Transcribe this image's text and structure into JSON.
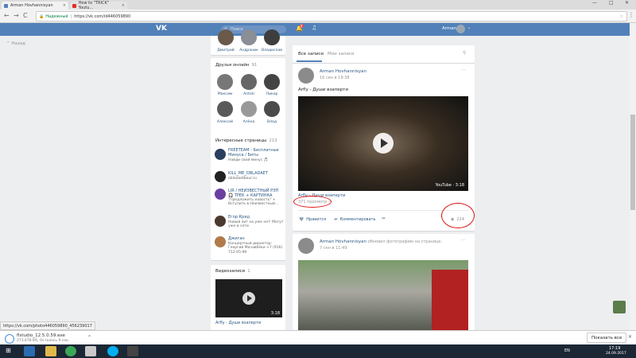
{
  "browser": {
    "tabs": [
      {
        "label": "Arman Hovhannisyan"
      },
      {
        "label": "How to \"TRICK\" Youtu..."
      }
    ],
    "nav": {
      "back": "←",
      "forward": "→",
      "reload": "C"
    },
    "address": {
      "secure_label": "Надежный",
      "url": "https://vk.com/id446059890"
    },
    "window_controls": {
      "minimize": "—",
      "maximize": "□",
      "close": "✕"
    }
  },
  "vk_header": {
    "logo": "VK",
    "search_placeholder": "Поиск",
    "notifications_count": "8",
    "user_name": "Arman"
  },
  "left_nav": {
    "back_label": "Назад"
  },
  "friends_top": {
    "names": [
      "Дмитрий",
      "Андраник",
      "Владислав"
    ]
  },
  "friends_online": {
    "title": "Друзья онлайн",
    "count": "91",
    "names": [
      "Максим",
      "Antoti",
      "Ликар",
      "Алексей",
      "Алёна",
      "Влад"
    ]
  },
  "interesting_pages": {
    "title": "Интересные страницы",
    "count": "213",
    "items": [
      {
        "name": "FREETEAM - Бесплатные Минуса / Биты",
        "desc": "Найди свой минус 🎵"
      },
      {
        "name": "KILL_ME_OBLADAET",
        "desc": "obladaetbour.ru"
      },
      {
        "name": "LIR / НЕИЗВЕСТНЫЙ РЭП 🎧 ТРЕК + КАРТИНКА",
        "desc": "\"Предложить новость\" + Вступить в Неизвестный..."
      },
      {
        "name": "Егор Крид",
        "desc": "Новый хит на уже не!! Могут уже в сети"
      },
      {
        "name": "Джиган",
        "desc": "Концертный директор: Георгий Мачавбёки +7 (916) 712-05-99"
      }
    ]
  },
  "videos": {
    "title": "Видеозаписи",
    "count": "1",
    "duration": "3:18",
    "caption": "Arfly - Души взаперти"
  },
  "feed": {
    "tabs": [
      {
        "label": "Все записи"
      },
      {
        "label": "Мои записи"
      }
    ],
    "post1": {
      "author": "Arman Hovhannisyan",
      "date": "16 сен в 19:38",
      "text": "Arfly - Души взаперти",
      "video_badge": "YouTube · 3:18",
      "video_title": "Arfly - Души взаперти",
      "views_line": "371 просмотр",
      "like_label": "Нравится",
      "comment_label": "Комментировать",
      "view_count": "224"
    },
    "post2": {
      "author": "Arman Hovhannisyan",
      "action": "обновил фотографию на странице.",
      "date": "7 сен в 11:49"
    }
  },
  "status_url": "https://vk.com/photo446059890_456239017",
  "download": {
    "filename": "flstudio_12.5.0.59.exe",
    "progress_text": "273.678 Кб, Осталось 9 сек.",
    "show_all": "Показать все"
  },
  "taskbar": {
    "lang": "EN",
    "time": "17:19",
    "date": "24.09.2017"
  },
  "colors": {
    "vk_blue": "#5181b8",
    "link": "#2a5885",
    "annotation_red": "#dd1111"
  }
}
